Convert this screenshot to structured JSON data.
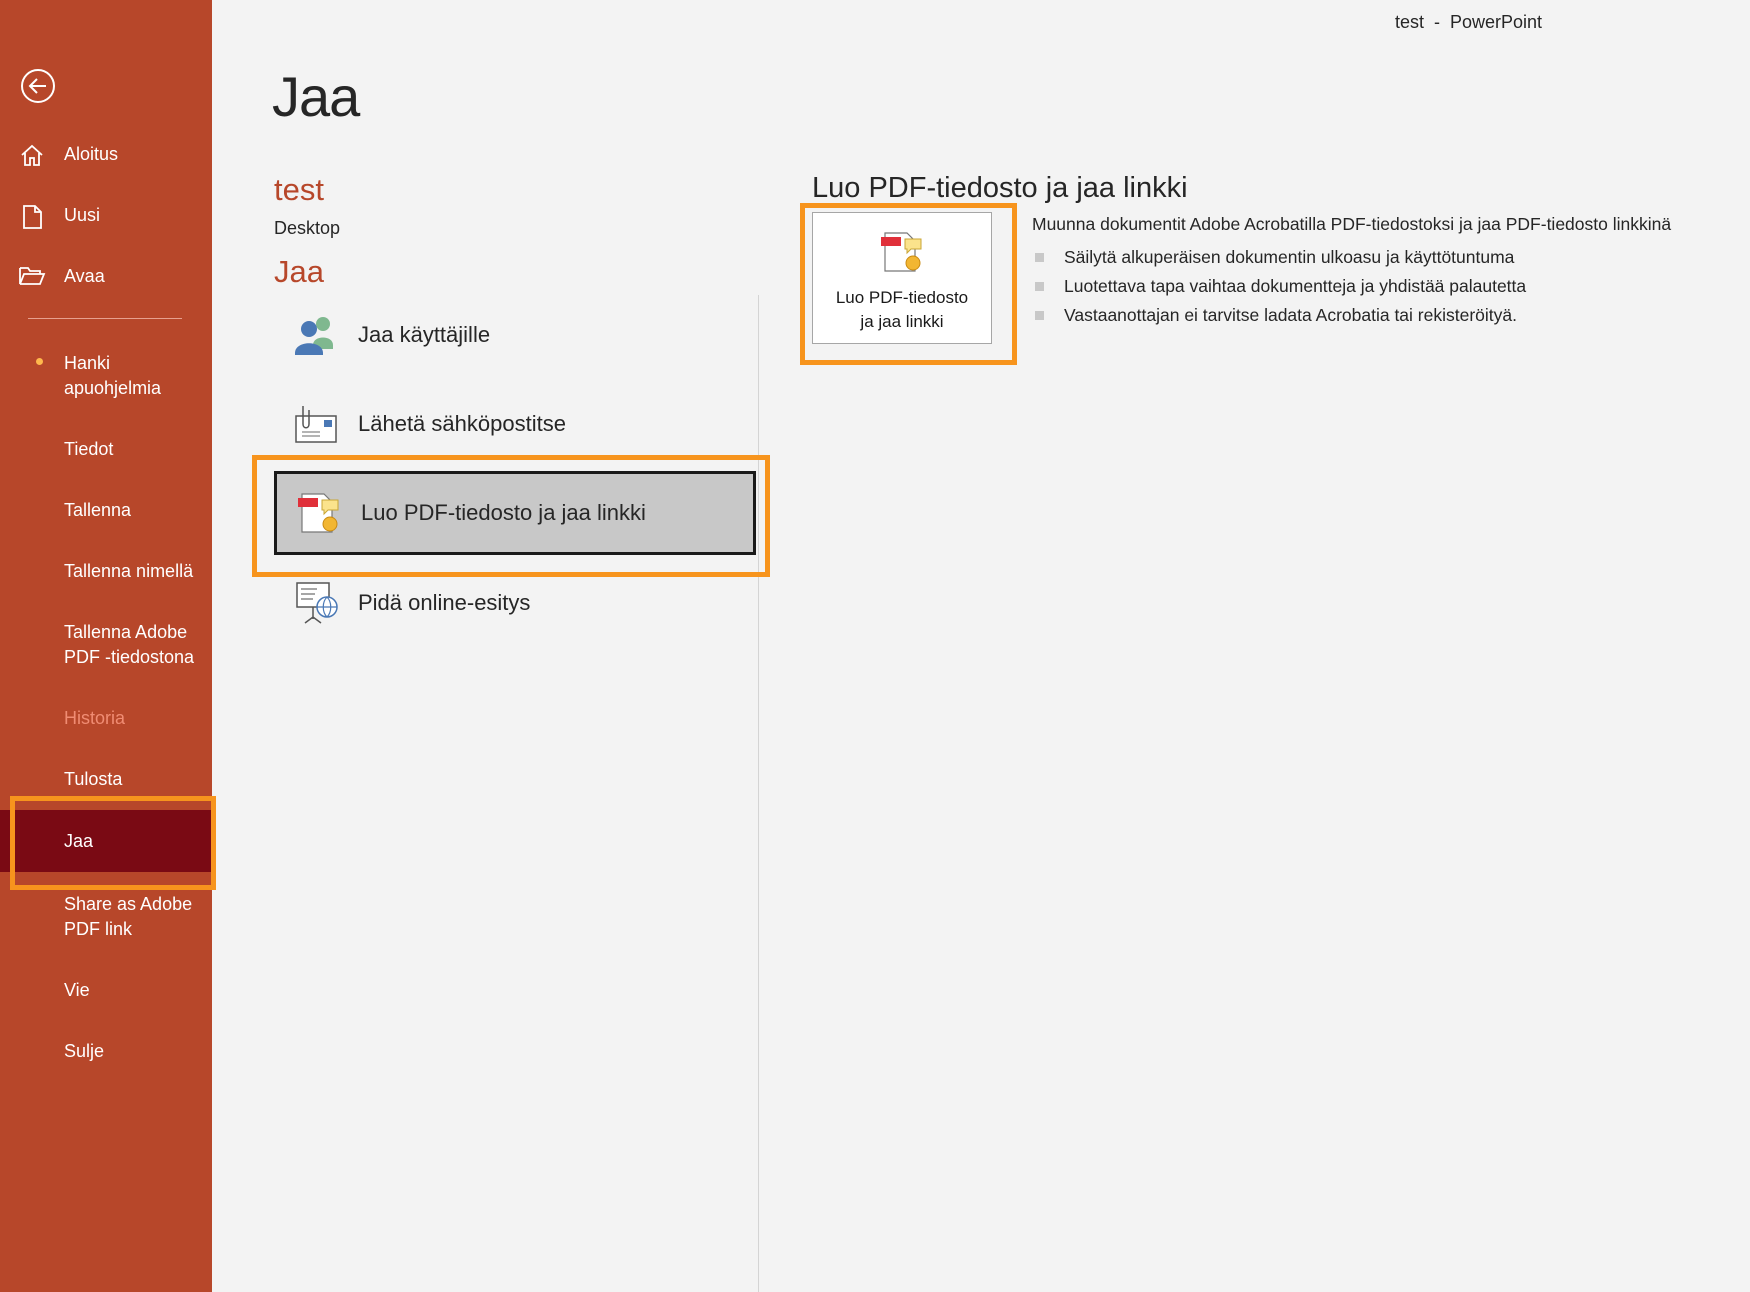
{
  "window": {
    "title": "test  -  PowerPoint"
  },
  "sidebar": {
    "back_icon": "back-arrow-icon",
    "items": [
      {
        "label": "Aloitus",
        "icon": "home-icon"
      },
      {
        "label": "Uusi",
        "icon": "new-document-icon"
      },
      {
        "label": "Avaa",
        "icon": "open-folder-icon"
      },
      {
        "label": "Hanki apuohjelmia"
      },
      {
        "label": "Tiedot"
      },
      {
        "label": "Tallenna"
      },
      {
        "label": "Tallenna nimellä"
      },
      {
        "label": "Tallenna Adobe PDF -tiedostona"
      },
      {
        "label": "Historia",
        "state": "disabled"
      },
      {
        "label": "Tulosta"
      },
      {
        "label": "Jaa",
        "state": "selected"
      },
      {
        "label": "Share as Adobe PDF link"
      },
      {
        "label": "Vie"
      },
      {
        "label": "Sulje"
      }
    ]
  },
  "main": {
    "page_title": "Jaa",
    "document": {
      "name": "test",
      "location": "Desktop"
    },
    "section_heading": "Jaa",
    "share_options": [
      {
        "label": "Jaa käyttäjille",
        "icon": "share-people-icon"
      },
      {
        "label": "Lähetä sähköpostitse",
        "icon": "email-attachment-icon"
      },
      {
        "label": "Luo PDF-tiedosto ja jaa linkki",
        "icon": "pdf-share-link-icon",
        "state": "selected"
      },
      {
        "label": "Pidä online-esitys",
        "icon": "online-presentation-icon"
      }
    ]
  },
  "right_panel": {
    "heading": "Luo PDF-tiedosto ja jaa linkki",
    "button_label": "Luo PDF-tiedosto ja jaa linkki",
    "button_icon": "pdf-share-link-icon",
    "description": "Muunna dokumentit Adobe Acrobatilla PDF-tiedostoksi ja jaa PDF-tiedosto linkkinä",
    "bullets": [
      "Säilytä alkuperäisen dokumentin ulkoasu ja käyttötuntuma",
      "Luotettava tapa vaihtaa dokumentteja ja yhdistää palautetta",
      "Vastaanottajan ei tarvitse ladata Acrobatia tai rekisteröityä."
    ]
  },
  "colors": {
    "sidebar_bg": "#b7472a",
    "sidebar_selected": "#7a0a14",
    "accent_text": "#b7472a",
    "highlight_outline": "#f7941d"
  }
}
